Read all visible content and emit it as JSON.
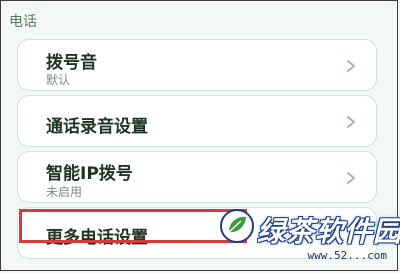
{
  "section": {
    "title": "电话"
  },
  "settings": [
    {
      "label": "拨号音",
      "sublabel": "默认",
      "icon": "chevron-right-icon"
    },
    {
      "label": "通话录音设置",
      "icon": "chevron-right-icon"
    },
    {
      "label": "智能IP拨号",
      "sublabel": "未启用",
      "icon": "chevron-right-icon"
    },
    {
      "label": "更多电话设置",
      "icon": "chevron-right-icon"
    }
  ],
  "watermark": {
    "brand": "绿茶软件园",
    "url": "www.52...com"
  },
  "colors": {
    "accent_border": "#cfe3d8",
    "highlight": "#d63b3b",
    "chevron": "#9fb8aa"
  }
}
